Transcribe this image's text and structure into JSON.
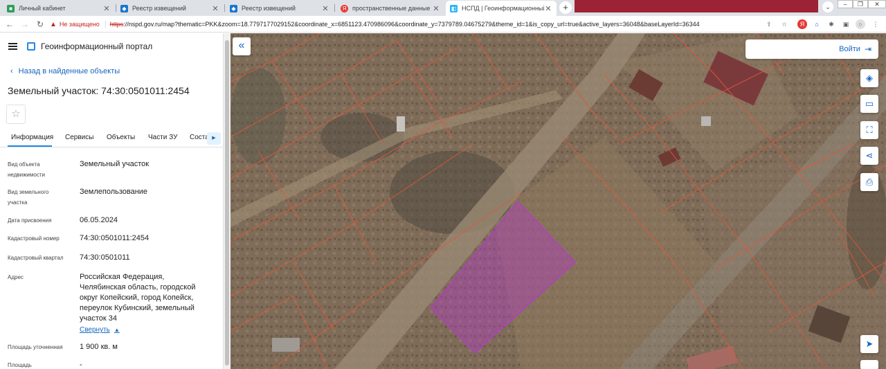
{
  "browser": {
    "tabs": [
      {
        "title": "Личный кабинет",
        "icon": "green-square-icon"
      },
      {
        "title": "Реестр извещений",
        "icon": "emblem-icon"
      },
      {
        "title": "Реестр извещений",
        "icon": "emblem-icon"
      },
      {
        "title": "пространственные данные рос",
        "icon": "yandex-icon"
      },
      {
        "title": "НСПД | Геоинформационный п",
        "icon": "nspd-icon",
        "active": true
      }
    ],
    "new_tab": "+",
    "address": {
      "security_label": "Не защищено",
      "scheme": "https",
      "url": "://nspd.gov.ru/map?thematic=PKK&zoom=18.7797177029152&coordinate_x=6851123.470986096&coordinate_y=7379789.04675279&theme_id=1&is_copy_url=true&active_layers=36048&baseLayerId=36344"
    },
    "accent_color": "#9b2335"
  },
  "panel": {
    "portal_title": "Геоинформационный портал",
    "back_link": "Назад в найденные объекты",
    "object_title": "Земельный участок: 74:30:0501011:2454",
    "tabs": [
      "Информация",
      "Сервисы",
      "Объекты",
      "Части ЗУ",
      "Состав"
    ],
    "fields": [
      {
        "label": "Вид объекта недвижимости",
        "value": "Земельный участок"
      },
      {
        "label": "Вид земельного участка",
        "value": "Землепользование"
      },
      {
        "label": "Дата присвоения",
        "value": "06.05.2024"
      },
      {
        "label": "Кадастровый номер",
        "value": "74:30:0501011:2454"
      },
      {
        "label": "Кадастровый квартал",
        "value": "74:30:0501011"
      },
      {
        "label": "Адрес",
        "value": "Российская Федерация, Челябинская область, городской округ Копейский, город Копейск, переулок Кубинский, земельный участок 34"
      },
      {
        "label": "Площадь уточненная",
        "value": "1 900 кв. м"
      },
      {
        "label": "Площадь",
        "value": "-"
      }
    ],
    "collapse_link": "Свернуть",
    "accent_color": "#1e88e5"
  },
  "map": {
    "login_label": "Войти",
    "tools": [
      "layers-icon",
      "ruler-icon",
      "select-area-icon",
      "share-icon",
      "print-icon",
      "navigate-icon"
    ],
    "selection_color": "#b13fbf"
  }
}
